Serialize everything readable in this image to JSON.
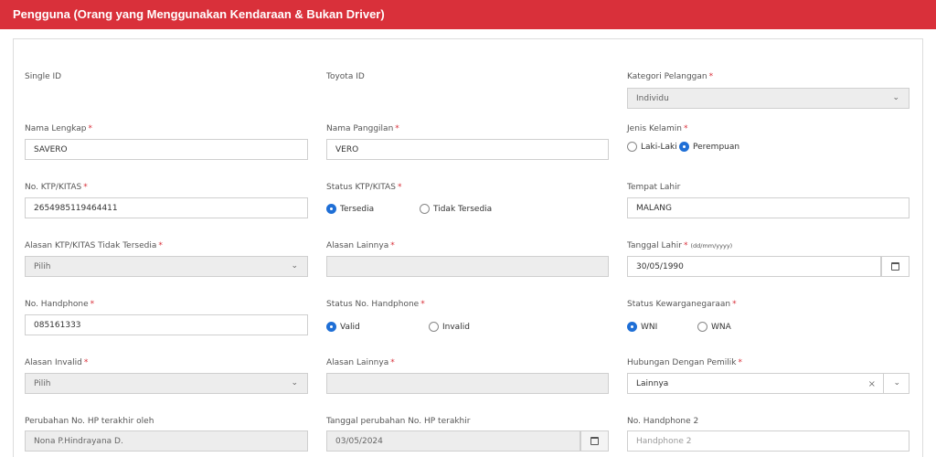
{
  "header": {
    "title": "Pengguna (Orang yang Menggunakan Kendaraan & Bukan Driver)"
  },
  "fields": {
    "single_id": {
      "label": "Single ID"
    },
    "toyota_id": {
      "label": "Toyota ID"
    },
    "kategori_pelanggan": {
      "label": "Kategori Pelanggan",
      "value": "Individu"
    },
    "nama_lengkap": {
      "label": "Nama Lengkap",
      "value": "SAVERO"
    },
    "nama_panggilan": {
      "label": "Nama Panggilan",
      "value": "VERO"
    },
    "jenis_kelamin": {
      "label": "Jenis Kelamin",
      "options": [
        "Laki-Laki",
        "Perempuan"
      ],
      "selected": "Perempuan"
    },
    "no_ktp": {
      "label": "No. KTP/KITAS",
      "value": "2654985119464411"
    },
    "status_ktp": {
      "label": "Status KTP/KITAS",
      "options": [
        "Tersedia",
        "Tidak Tersedia"
      ],
      "selected": "Tersedia"
    },
    "tempat_lahir": {
      "label": "Tempat Lahir",
      "value": "MALANG"
    },
    "alasan_ktp": {
      "label": "Alasan KTP/KITAS Tidak Tersedia",
      "value": "Pilih"
    },
    "alasan_lainnya_1": {
      "label": "Alasan Lainnya",
      "value": ""
    },
    "tanggal_lahir": {
      "label": "Tanggal Lahir",
      "hint": "(dd/mm/yyyy)",
      "value": "30/05/1990"
    },
    "no_handphone": {
      "label": "No. Handphone",
      "value": "085161333"
    },
    "status_handphone": {
      "label": "Status No. Handphone",
      "options": [
        "Valid",
        "Invalid"
      ],
      "selected": "Valid"
    },
    "status_kewarganegaraan": {
      "label": "Status Kewarganegaraan",
      "options": [
        "WNI",
        "WNA"
      ],
      "selected": "WNI"
    },
    "alasan_invalid": {
      "label": "Alasan Invalid",
      "value": "Pilih"
    },
    "alasan_lainnya_2": {
      "label": "Alasan Lainnya",
      "value": ""
    },
    "hubungan_pemilik": {
      "label": "Hubungan Dengan Pemilik",
      "value": "Lainnya"
    },
    "perubahan_hp_oleh": {
      "label": "Perubahan No. HP terakhir oleh",
      "value": "Nona P.Hindrayana D."
    },
    "tanggal_perubahan_hp": {
      "label": "Tanggal perubahan No. HP terakhir",
      "value": "03/05/2024"
    },
    "no_handphone_2": {
      "label": "No. Handphone 2",
      "placeholder": "Handphone 2"
    }
  },
  "required_marker": "*",
  "icons": {
    "chevron": "chevron-down-icon",
    "calendar": "calendar-icon",
    "clear": "clear-icon"
  },
  "colors": {
    "header_bg": "#d9303a",
    "radio_checked": "#1f6fd6",
    "required": "#d9303a"
  }
}
